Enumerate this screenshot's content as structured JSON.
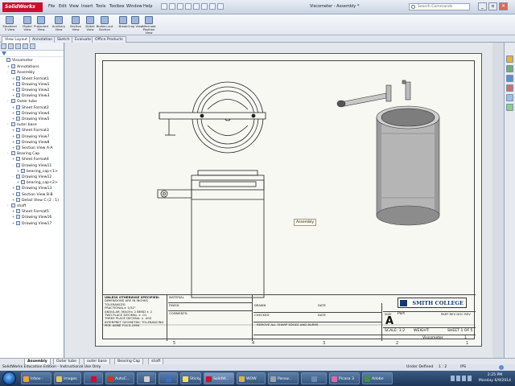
{
  "app": {
    "logo_text": "SolidWorks",
    "document_title": "Viscometer - Assembly *"
  },
  "menu": [
    "File",
    "Edit",
    "View",
    "Insert",
    "Tools",
    "Toolbox",
    "Window",
    "Help"
  ],
  "search": {
    "placeholder": "Search Commands"
  },
  "window_buttons": [
    "_",
    "▫",
    "✕"
  ],
  "ribbon": {
    "buttons": [
      "Standard 3 View",
      "Model View",
      "Projected View",
      "Auxiliary View",
      "Section View",
      "Detail View",
      "Broken-out Section",
      "Break",
      "Crop View",
      "Alternate Position View"
    ]
  },
  "tabs": [
    "View Layout",
    "Annotation",
    "Sketch",
    "Evaluate",
    "Office Products"
  ],
  "tree": {
    "nodes": [
      {
        "label": "Viscometer",
        "indent": 0,
        "exp": ""
      },
      {
        "label": "Annotations",
        "indent": 1,
        "exp": "+"
      },
      {
        "label": "Assembly",
        "indent": 1,
        "exp": "-"
      },
      {
        "label": "Sheet Format1",
        "indent": 2,
        "exp": "+"
      },
      {
        "label": "Drawing View1",
        "indent": 2,
        "exp": "+"
      },
      {
        "label": "Drawing View2",
        "indent": 2,
        "exp": "+"
      },
      {
        "label": "Drawing View3",
        "indent": 2,
        "exp": "+"
      },
      {
        "label": "Outer tube",
        "indent": 1,
        "exp": "-"
      },
      {
        "label": "Sheet Format2",
        "indent": 2,
        "exp": "+"
      },
      {
        "label": "Drawing View4",
        "indent": 2,
        "exp": "+"
      },
      {
        "label": "Drawing View5",
        "indent": 2,
        "exp": "+"
      },
      {
        "label": "outer base",
        "indent": 1,
        "exp": "-"
      },
      {
        "label": "Sheet Format3",
        "indent": 2,
        "exp": "+"
      },
      {
        "label": "Drawing View7",
        "indent": 2,
        "exp": "+"
      },
      {
        "label": "Drawing View8",
        "indent": 2,
        "exp": "+"
      },
      {
        "label": "Section View A-A",
        "indent": 2,
        "exp": "+"
      },
      {
        "label": "Bearing Cap",
        "indent": 1,
        "exp": "-"
      },
      {
        "label": "Sheet Format4",
        "indent": 2,
        "exp": "+"
      },
      {
        "label": "Drawing View11",
        "indent": 2,
        "exp": "-"
      },
      {
        "label": "bearing_cap<1>",
        "indent": 3,
        "exp": "+"
      },
      {
        "label": "Drawing View12",
        "indent": 2,
        "exp": "-"
      },
      {
        "label": "bearing_cap<2>",
        "indent": 3,
        "exp": "+"
      },
      {
        "label": "Drawing View13",
        "indent": 2,
        "exp": "+"
      },
      {
        "label": "Section View B-B",
        "indent": 2,
        "exp": "+"
      },
      {
        "label": "Detail View C (2 : 1)",
        "indent": 2,
        "exp": "+"
      },
      {
        "label": "shaft",
        "indent": 1,
        "exp": "-"
      },
      {
        "label": "Sheet Format5",
        "indent": 2,
        "exp": "+"
      },
      {
        "label": "Drawing View16",
        "indent": 2,
        "exp": "+"
      },
      {
        "label": "Drawing View17",
        "indent": 2,
        "exp": "+"
      }
    ]
  },
  "sheet": {
    "zones_bottom": [
      "5",
      "4",
      "3",
      "2",
      "1"
    ],
    "tooltip": "Assembly",
    "title_block": {
      "unless": "UNLESS OTHERWISE SPECIFIED:",
      "dims_lines": [
        "DIMENSIONS ARE IN INCHES",
        "TOLERANCES:",
        "FRACTIONAL± 1/32\"",
        "ANGULAR: MACH± 2 BEND ± 2",
        "TWO PLACE DECIMAL    ± .01",
        "THREE PLACE DECIMAL  ± .005"
      ],
      "interpret": "INTERPRET GEOMETRIC TOLERANCING PER: ASME Y14.5-1994",
      "material": "MATERIAL",
      "finish": "FINISH",
      "comments": "COMMENTS:",
      "drawn": "DRAWN",
      "checked": "CHECKED",
      "date": "DATE",
      "remove": "REMOVE ALL SHARP EDGES AND BURRS",
      "college": "SMITH COLLEGE",
      "size_label": "SIZE",
      "size": "A",
      "part_label": "Part",
      "rev_label": "PART REV  DOC REV",
      "scale": "SCALE: 1:2",
      "weight": "WEIGHT:",
      "sheet": "SHEET 1 OF 5",
      "name": "Viscometer",
      "rev": "1"
    }
  },
  "sheet_tabs": [
    "Assembly",
    "Outer tube",
    "outer base",
    "Bearing Cap",
    "shaft"
  ],
  "status": {
    "left": "SolidWorks Education Edition - Instructional Use Only",
    "defined": "Under Defined",
    "scale": "1 : 2",
    "units": "IPS"
  },
  "taskbar": {
    "items": [
      "Inbox -",
      "images",
      "AutoC...",
      "Sticky",
      "SolidW...",
      "WOW",
      "Passw...",
      "Picasa 3",
      "Adobe"
    ],
    "time": "2:25 PM",
    "date": "Monday 6/9/2014"
  },
  "colors": {
    "brand": "#c8102e",
    "taskbar": "#1d3658"
  }
}
